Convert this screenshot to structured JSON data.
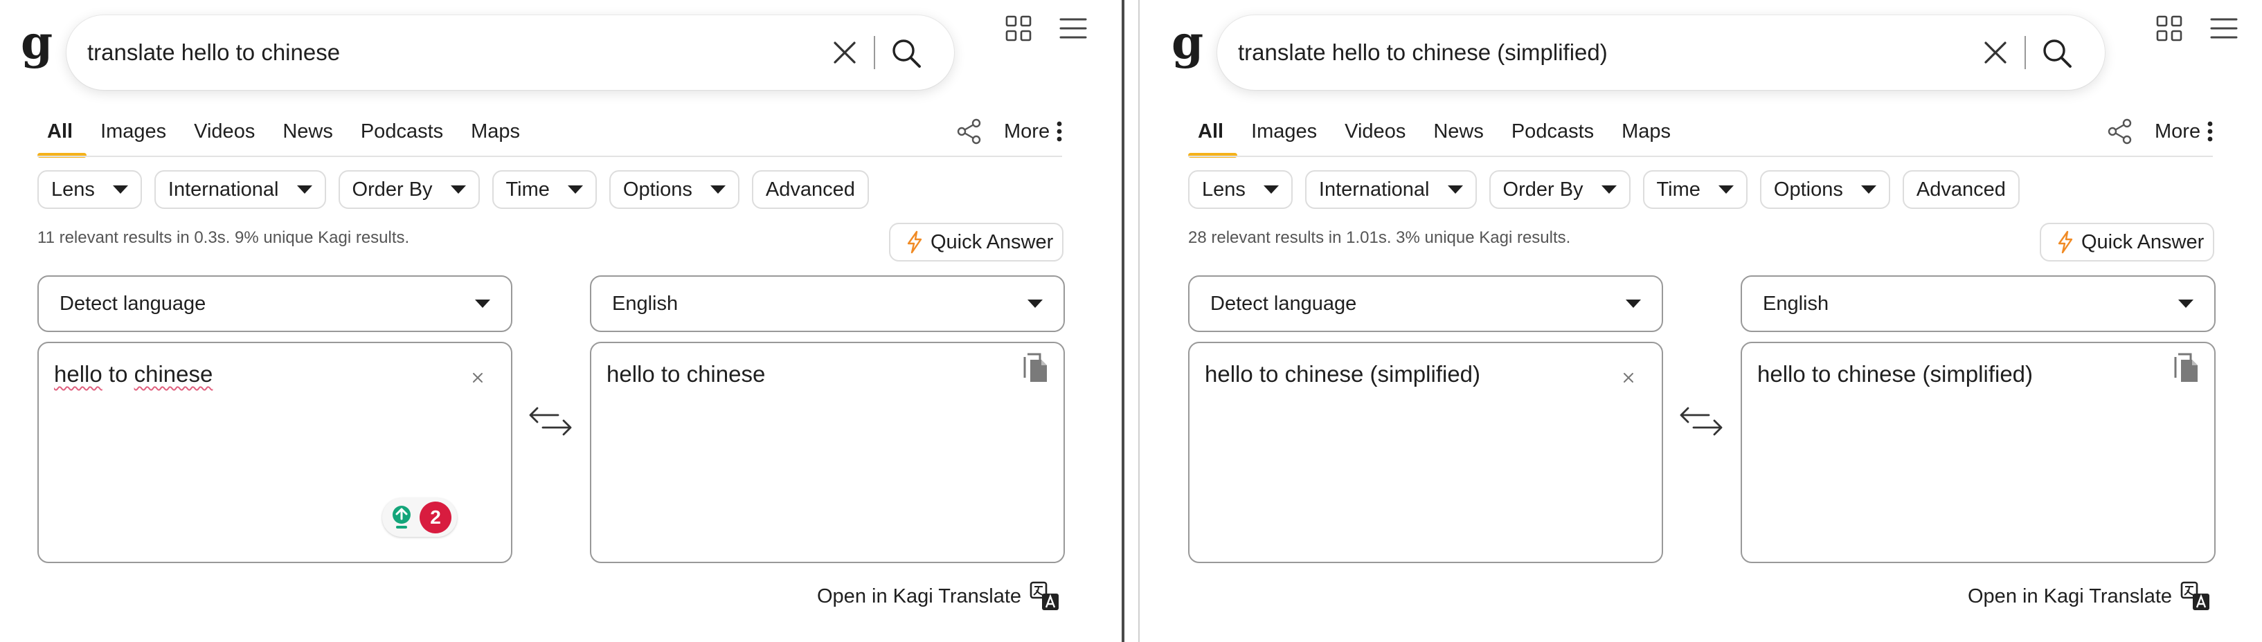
{
  "logo": "g",
  "nav": {
    "tabs": [
      "All",
      "Images",
      "Videos",
      "News",
      "Podcasts",
      "Maps"
    ],
    "more_label": "More"
  },
  "filters": [
    {
      "label": "Lens",
      "dropdown": true
    },
    {
      "label": "International",
      "dropdown": true
    },
    {
      "label": "Order By",
      "dropdown": true
    },
    {
      "label": "Time",
      "dropdown": true
    },
    {
      "label": "Options",
      "dropdown": true
    },
    {
      "label": "Advanced",
      "dropdown": false
    }
  ],
  "quick_answer_label": "Quick Answer",
  "open_translate_label": "Open in Kagi Translate",
  "colors": {
    "accent": "#f5b21b",
    "quick_answer_icon": "#f08a24",
    "spellcheck_underline": "#e0607e",
    "grammar_badge": "#d81c3f",
    "grammar_icon": "#14a57a"
  },
  "panes": [
    {
      "query": "translate hello to chinese",
      "stats": "11 relevant results in 0.3s. 9% unique Kagi results.",
      "source_lang": "Detect language",
      "target_lang": "English",
      "source_text_parts": [
        {
          "text": "hello",
          "misspelled": true
        },
        {
          "text": " to ",
          "misspelled": false
        },
        {
          "text": "chinese",
          "misspelled": true
        }
      ],
      "output_text": "hello to chinese",
      "grammar_count": "2"
    },
    {
      "query": "translate hello to chinese (simplified)",
      "stats": "28 relevant results in 1.01s. 3% unique Kagi results.",
      "source_lang": "Detect language",
      "target_lang": "English",
      "source_text_parts": [
        {
          "text": "hello to chinese (simplified)",
          "misspelled": false
        }
      ],
      "output_text": "hello to chinese (simplified)",
      "grammar_count": null
    }
  ]
}
